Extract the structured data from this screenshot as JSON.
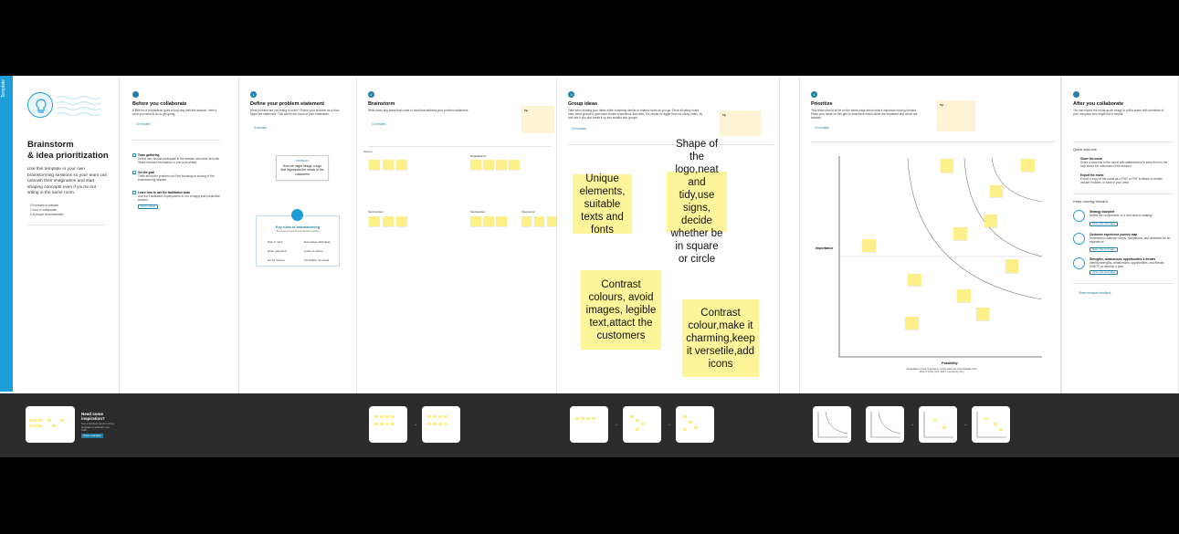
{
  "side_tag": "Template",
  "intro": {
    "title_line1": "Brainstorm",
    "title_line2": "& idea prioritization",
    "description": "Use this template in your own brainstorming sessions so your team can unleash their imagination and start shaping concepts even if you're not sitting in the same room.",
    "meta": [
      "10 minutes to prepare",
      "1 hour to collaborate",
      "2-8 people recommended"
    ],
    "footer_title": "Need some inspiration?",
    "footer_text": "See a finished version of this template to kickstart your work.",
    "footer_button": "Open example"
  },
  "steps": [
    {
      "num": "",
      "title": "Before you collaborate",
      "text": "A little bit of preparation goes a long way with this session. Here's what you need to do to get going.",
      "time": "10 minutes"
    },
    {
      "num": "1",
      "title": "Define your problem statement",
      "text": "What problem are you trying to solve? Frame your problem as a How Might We statement. This will be the focus of your brainstorm.",
      "time": "5 minutes"
    },
    {
      "num": "2",
      "title": "Brainstorm",
      "text": "Write down any ideas that come to mind that address your problem statement.",
      "time": "10 minutes"
    },
    {
      "num": "3",
      "title": "Group ideas",
      "text": "Take turns sharing your ideas while clustering similar or related notes as you go. Once all sticky notes have been grouped, give each cluster a sentence-like label. If a cluster is bigger than six sticky notes, try and see if you and break it up into smaller sub-groups.",
      "time": "20 minutes"
    },
    {
      "num": "4",
      "title": "Prioritize",
      "text": "Your team should all be on the same page about what's important moving forward. Place your ideas on this grid to determine which ideas are important and which are feasible.",
      "time": "20 minutes"
    },
    {
      "num": "",
      "title": "After you collaborate",
      "text": "You can export the mural as an image or pdf to share with members of your company who might find it helpful.",
      "time": ""
    }
  ],
  "prep_items": [
    {
      "title": "Team gathering",
      "text": "Define who should participate in the session and send an invite. Share relevant information or pre-work ahead."
    },
    {
      "title": "Set the goal",
      "text": "Think about the problem you'll be focusing on solving in the brainstorming session."
    },
    {
      "title": "Learn how to use the facilitation tools",
      "text": "Use the Facilitation Superpowers to run a happy and productive session."
    }
  ],
  "prep_button": "Open article",
  "problem_card": {
    "label": "PROBLEM",
    "text": "How we might design a logo that impresses the minds of the customers"
  },
  "rules": {
    "title": "Key rules of brainstorming",
    "subtitle": "To run an smooth and productive session",
    "items": [
      "Stay in topic.",
      "Encourage wild ideas.",
      "Defer judgment.",
      "Listen to others.",
      "Go for volume.",
      "If possible, be visual."
    ]
  },
  "brainstorm_people": [
    "Person",
    "Ragalakshmi",
    "Santhosham",
    "Manikandan",
    "Vijaykumar"
  ],
  "ideas": [
    "Unique elements, suitable texts and fonts",
    "Shape of the logo,neat and tidy,use signs, decide  whether be in square or circle",
    "Contrast colours, avoid images, legible text,attact the customers",
    "Contrast colour,make it charming,keep it versetile,add icons"
  ],
  "prioritize": {
    "y_label": "Importance",
    "x_label": "Feasibility",
    "x_note": "Regardless of their importance, which tasks are more feasible than others? (Cost, time, effort, complexity, etc.)"
  },
  "after": {
    "quick_title": "Quick add-ons",
    "quick": [
      {
        "title": "Share the mural",
        "text": "Share a view link to the mural with stakeholders to keep them in the loop about the outcomes of the session."
      },
      {
        "title": "Export the mural",
        "text": "Export a copy of the mural as a PNG or PDF to attach to emails, include in slides, or save in your drive."
      }
    ],
    "forward_title": "Keep moving forward",
    "forward": [
      {
        "title": "Strategy blueprint",
        "text": "Define the components of a new idea or strategy.",
        "button": "Open the template"
      },
      {
        "title": "Customer experience journey map",
        "text": "Understand customer needs, motivations, and obstacles for an experience.",
        "button": "Open the template"
      },
      {
        "title": "Strengths, weaknesses, opportunities & threats",
        "text": "Identify strengths, weaknesses, opportunities, and threats (SWOT) to develop a plan.",
        "button": "Open the template"
      }
    ],
    "feedback": "Share template feedback"
  },
  "tip_label": "Tip",
  "colors": {
    "accent": "#1e9ed9",
    "sticky": "#fdf08a",
    "footer": "#2b2b2b"
  }
}
